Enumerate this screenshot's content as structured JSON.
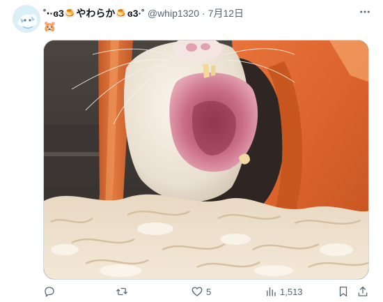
{
  "author": {
    "display_name": "◟̆◞̆˚‧₍ᐢ.ˬ.ᐢ₎🍮やわらか🍮₍ᐢ.ˬ.ᐢ₎‧˚",
    "display_name_short": "˚‧·ɞ3🍮やわらか🍮ɞ3·˚",
    "handle": "@whip1320",
    "separator": "·",
    "date": "7月12日"
  },
  "tweet": {
    "text": "🐹"
  },
  "media": {
    "description_icon": "photo-hamster-yawning"
  },
  "actions": {
    "reply": {
      "icon": "reply-icon",
      "count": ""
    },
    "retweet": {
      "icon": "retweet-icon",
      "count": ""
    },
    "like": {
      "icon": "heart-icon",
      "count": "5"
    },
    "views": {
      "icon": "views-icon",
      "count": "1,513"
    },
    "bookmark": {
      "icon": "bookmark-icon",
      "count": ""
    },
    "share": {
      "icon": "share-icon",
      "count": ""
    }
  },
  "colors": {
    "secondary_text": "#536471",
    "primary_text": "#0f1419",
    "border": "#cfd9de"
  }
}
